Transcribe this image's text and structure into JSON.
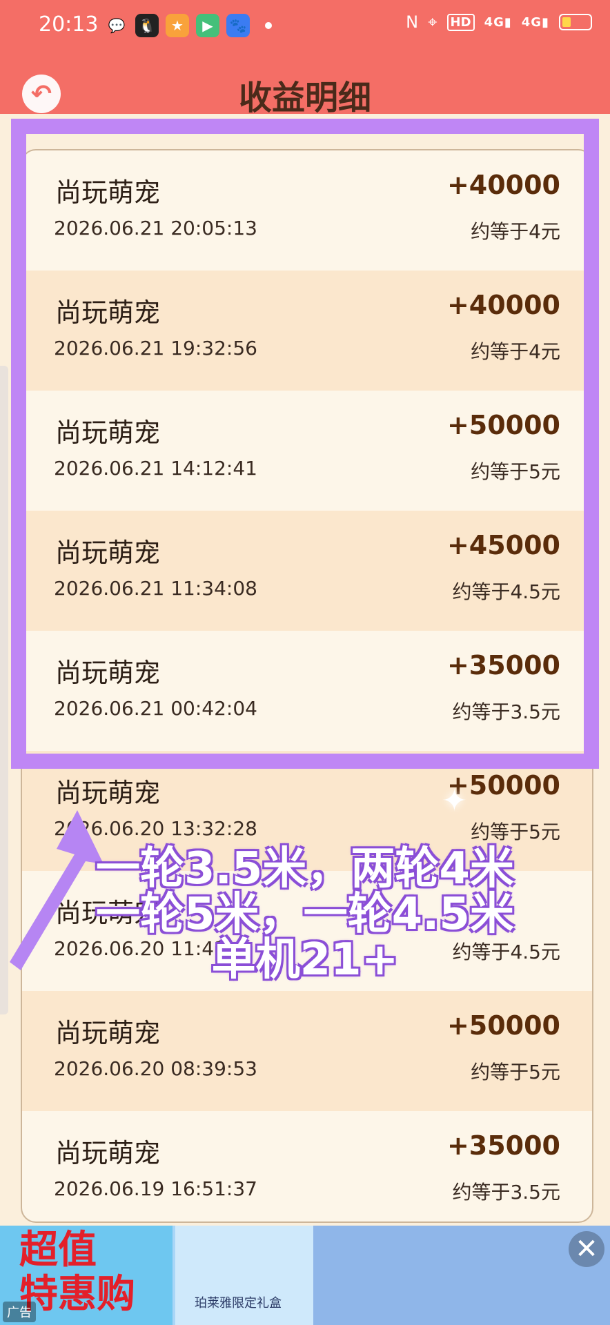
{
  "status_bar": {
    "time": "20:13",
    "hd": "HD",
    "net1": "4G",
    "net2": "4G"
  },
  "header": {
    "title": "收益明细"
  },
  "records": [
    {
      "name": "尚玩萌宠",
      "time": "2026.06.21 20:05:13",
      "amount": "+40000",
      "equiv": "约等于4元"
    },
    {
      "name": "尚玩萌宠",
      "time": "2026.06.21 19:32:56",
      "amount": "+40000",
      "equiv": "约等于4元"
    },
    {
      "name": "尚玩萌宠",
      "time": "2026.06.21 14:12:41",
      "amount": "+50000",
      "equiv": "约等于5元"
    },
    {
      "name": "尚玩萌宠",
      "time": "2026.06.21 11:34:08",
      "amount": "+45000",
      "equiv": "约等于4.5元"
    },
    {
      "name": "尚玩萌宠",
      "time": "2026.06.21 00:42:04",
      "amount": "+35000",
      "equiv": "约等于3.5元"
    },
    {
      "name": "尚玩萌宠",
      "time": "2026.06.20 13:32:28",
      "amount": "+50000",
      "equiv": "约等于5元"
    },
    {
      "name": "尚玩萌宠",
      "time": "2026.06.20 11:43",
      "amount": "",
      "equiv": "约等于4.5元"
    },
    {
      "name": "尚玩萌宠",
      "time": "2026.06.20 08:39:53",
      "amount": "+50000",
      "equiv": "约等于5元"
    },
    {
      "name": "尚玩萌宠",
      "time": "2026.06.19 16:51:37",
      "amount": "+35000",
      "equiv": "约等于3.5元"
    }
  ],
  "overlay": {
    "line1": "一轮3.5米，两轮4米",
    "line2": "一轮5米，一轮4.5米",
    "line3": "单机21+"
  },
  "ad": {
    "headline1": "超值",
    "headline2": "特惠购",
    "gift": "珀莱雅限定礼盒",
    "tag": "广告"
  },
  "colors": {
    "header": "#f46e66",
    "highlight": "#bf86f5",
    "amount": "#5a2c0a"
  }
}
